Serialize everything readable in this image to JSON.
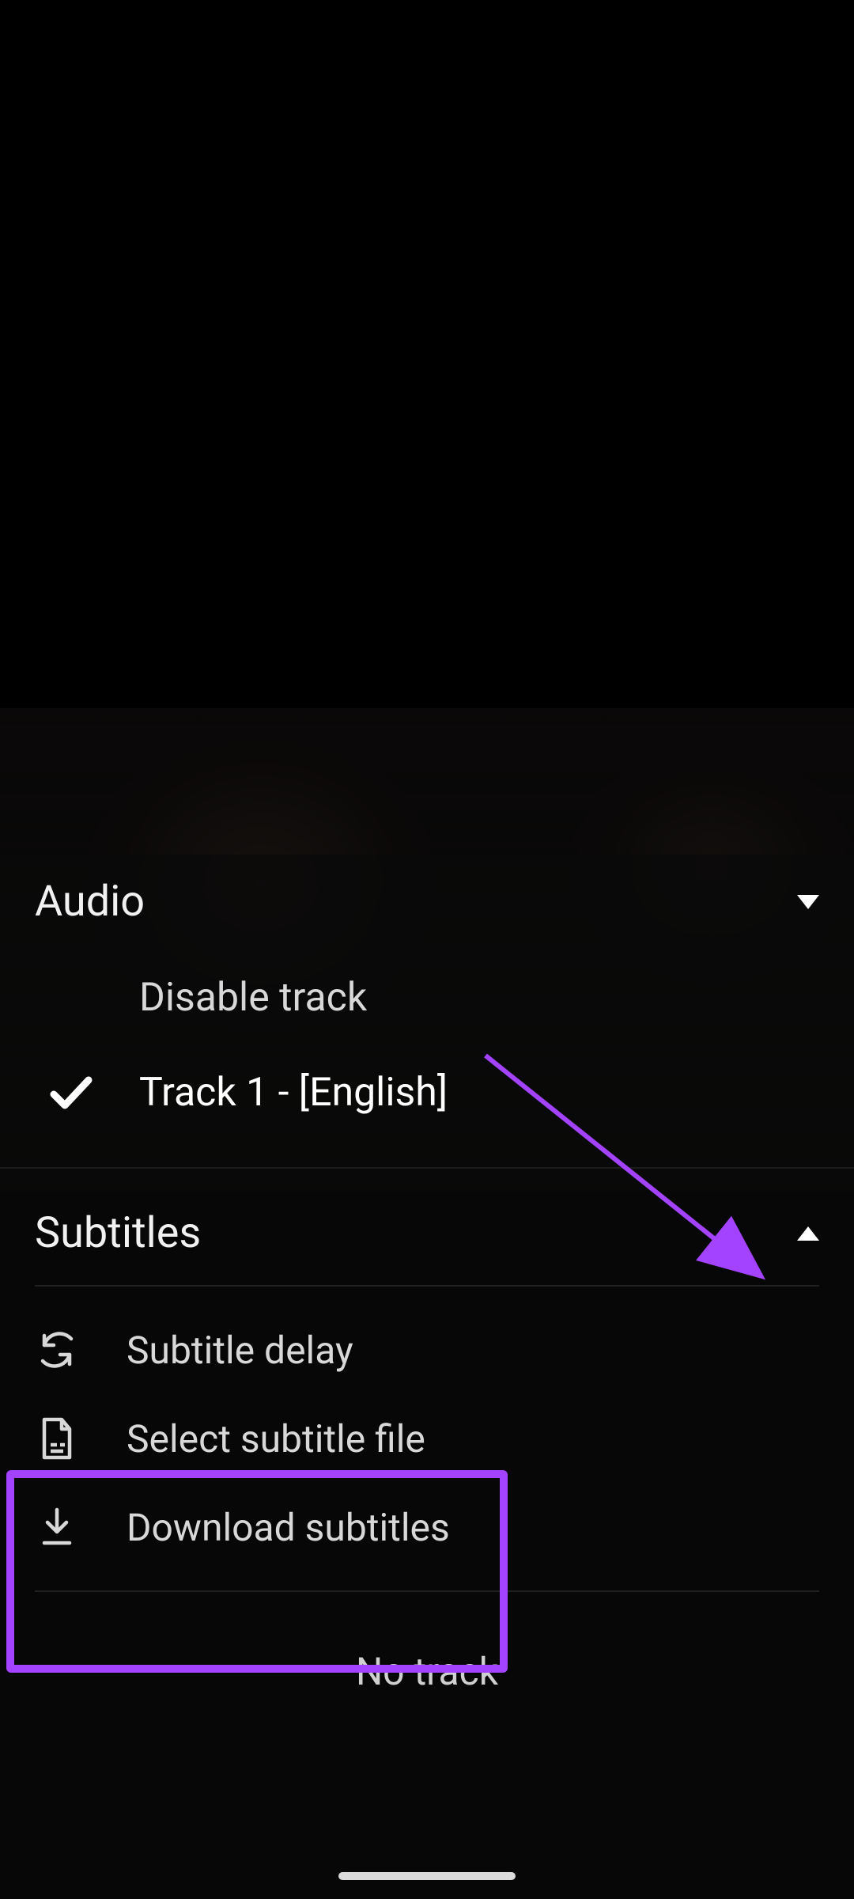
{
  "colors": {
    "accent": "#a342ff"
  },
  "audio": {
    "title": "Audio",
    "disable_label": "Disable track",
    "tracks": [
      {
        "label": "Track 1 - [English]",
        "selected": true
      }
    ]
  },
  "subtitles": {
    "title": "Subtitles",
    "actions": {
      "delay": "Subtitle delay",
      "select_file": "Select subtitle file",
      "download": "Download subtitles"
    },
    "no_track": "No track"
  }
}
